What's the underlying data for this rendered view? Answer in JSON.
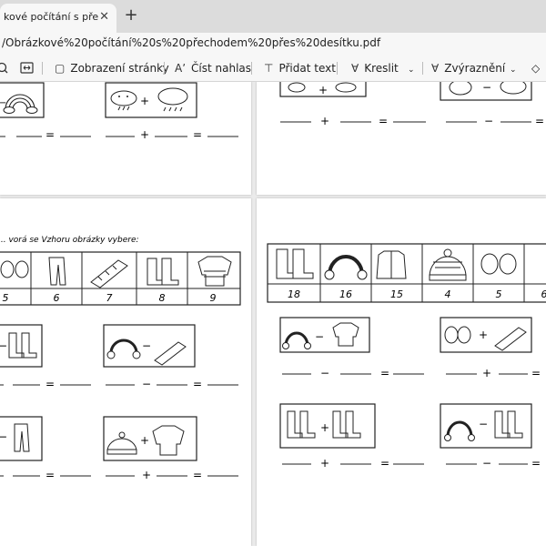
{
  "browser": {
    "tab_title": "kové počítání s přechodem",
    "close_glyph": "✕",
    "new_tab_glyph": "+",
    "address": "/Obrázkové%20počítání%20s%20přechodem%20přes%20desítku.pdf"
  },
  "toolbar": {
    "page_view_label": "Zobrazení stránky",
    "read_aloud_label": "Číst nahlas",
    "add_text_label": "Přidat text",
    "draw_label": "Kreslit",
    "highlight_label": "Zvýraznění"
  },
  "worksheet": {
    "instruction": "... vorá se Vzhoru obrázky vybere:",
    "left_prices": [
      "5",
      "6",
      "7",
      "8",
      "9"
    ],
    "right_prices": [
      "18",
      "16",
      "15",
      "4",
      "5",
      "6"
    ],
    "ops": {
      "plus": "+",
      "minus": "−",
      "equals": "="
    }
  }
}
